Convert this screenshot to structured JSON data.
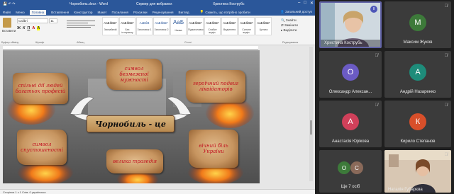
{
  "word": {
    "title": "Чорнобиль.docx - Word",
    "title_center": "Сервер для вибраних",
    "user": "Христина Кострубс",
    "tabs": [
      "Файл",
      "Меню",
      "Головна",
      "Вставлення",
      "Конструктор",
      "Макет",
      "Посилання",
      "Розсилки",
      "Рецензування",
      "Вигляд",
      "Довідка"
    ],
    "search_label": "Скажіть, що потрібно зробити",
    "share_label": "Загальний доступ",
    "paste_label": "Вставити",
    "font_name": "Calibri",
    "font_size": "11",
    "format_buttons": [
      "Ж",
      "К",
      "П",
      "A",
      "A"
    ],
    "styles": [
      {
        "preview": "АаБбВвГ",
        "name": "Звичайний"
      },
      {
        "preview": "АаБбВвГ",
        "name": "Без інтервалу"
      },
      {
        "preview": "АаБбВ",
        "name": "Заголовок 1"
      },
      {
        "preview": "АаБбВвГ",
        "name": "Заголовок 2"
      },
      {
        "preview": "АаБ",
        "name": "Назва"
      },
      {
        "preview": "АаБбВвГ",
        "name": "Підзаголовок"
      },
      {
        "preview": "АаБбВвГ",
        "name": "Слабке виділ."
      },
      {
        "preview": "АаБбВвГ",
        "name": "Виділення"
      },
      {
        "preview": "АаБбВвГ",
        "name": "Сильне виділ."
      },
      {
        "preview": "АаБбВвГ",
        "name": "Цитата"
      }
    ],
    "edit_items": [
      "Знайти",
      "Замінити",
      "Виділити"
    ],
    "group_labels": [
      "Буфер обміну",
      "Шрифт",
      "Абзац",
      "Стилі",
      "Редагування"
    ],
    "status_text": "Сторінка 1 з 1   Слів: 0   українська"
  },
  "collage": {
    "scroll_top_left": [
      "спільні дії людей",
      "багатьох професій"
    ],
    "scroll_top_center": [
      "символ",
      "безмежної мужності"
    ],
    "scroll_top_right": [
      "героїчний подвиг",
      "ліквідаторів"
    ],
    "banner": "Чорнобиль - це",
    "scroll_bottom_left": [
      "символ",
      "спустошеності"
    ],
    "scroll_bottom_center": [
      "велика трагедія"
    ],
    "scroll_bottom_right": [
      "вічний біль",
      "України"
    ]
  },
  "participants": [
    {
      "name": "Христина Кострубь",
      "type": "video",
      "mic": "on"
    },
    {
      "name": "Максим Жуков",
      "initial": "М",
      "color": "#3d7a3a",
      "mic": "off"
    },
    {
      "name": "Олександр Алексан...",
      "initial": "О",
      "color": "#6b5bc4",
      "mic": "off"
    },
    {
      "name": "Андрій Назаренко",
      "initial": "А",
      "color": "#1e8c7a",
      "mic": "off"
    },
    {
      "name": "Анастасія Юрікова",
      "initial": "А",
      "color": "#d0405a",
      "mic": "off"
    },
    {
      "name": "Кирило Степанов",
      "initial": "К",
      "color": "#d84f2a",
      "mic": "off"
    },
    {
      "name": "Ще 7 осіб",
      "initials": [
        "О",
        "С"
      ],
      "colors": [
        "#3d7a3a",
        "#8a6a5a"
      ]
    },
    {
      "name": "Наталія Губарєва",
      "type": "video",
      "mic": "off"
    }
  ]
}
